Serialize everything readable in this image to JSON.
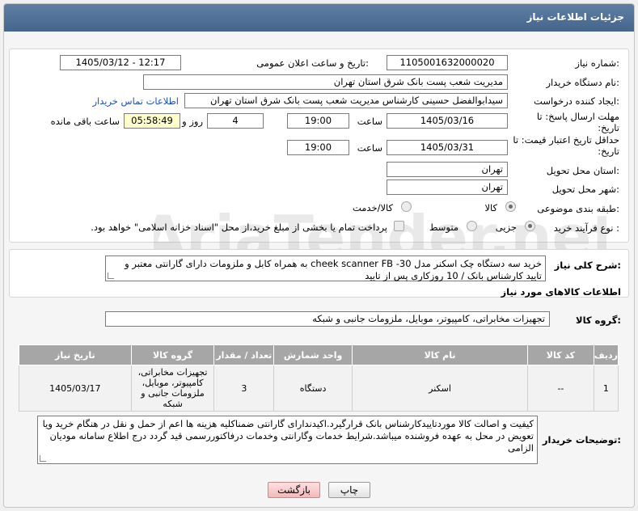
{
  "header": {
    "title": "جزئیات اطلاعات نیاز"
  },
  "form": {
    "need_number_label": "شماره نیاز:",
    "need_number": "1105001632000020",
    "announce_label": "تاریخ و ساعت اعلان عمومی:",
    "announce_value": "1405/03/12 - 12:17",
    "buyer_org_label": "نام دستگاه خریدار:",
    "buyer_org": "مدیریت شعب پست بانک شرق استان تهران",
    "requester_label": "ایجاد کننده درخواست:",
    "requester": "سیدابوالفضل حسینی کارشناس مدیریت شعب پست بانک شرق استان تهران",
    "contact_link": "اطلاعات تماس خریدار",
    "reply_deadline_label": "مهلت ارسال پاسخ: تا تاریخ:",
    "reply_date": "1405/03/16",
    "time_label": "ساعت",
    "reply_time": "19:00",
    "days_value": "4",
    "days_label": "روز و",
    "remaining_value": "05:58:49",
    "remaining_label": "ساعت باقی مانده",
    "price_validity_label": "حداقل تاریخ اعتبار قیمت: تا تاریخ:",
    "validity_date": "1405/03/31",
    "validity_time": "19:00",
    "province_label": "استان محل تحویل:",
    "province": "تهران",
    "city_label": "شهر محل تحویل:",
    "city": "تهران",
    "category_label": "طبقه بندی موضوعی:",
    "category_options": [
      "کالا",
      "کالا/خدمت"
    ],
    "process_label": "نوع فرآیند خرید :",
    "process_options": [
      "جزیی",
      "متوسط"
    ],
    "payment_note": "پرداخت تمام یا بخشی از مبلغ خرید،از محل \"اسناد خزانه اسلامی\" خواهد بود."
  },
  "summary": {
    "label": "شرح کلی نیاز:",
    "text": "خرید سه دستگاه چک اسکنر مدل cheek scanner FB -30 به همراه کابل و ملزومات دارای گارانتی معتبر و تایید کارشناس بانک / 10 روزکاری پس از تایید"
  },
  "goods": {
    "section_title": "اطلاعات کالاهای مورد نیاز",
    "group_label": "گروه کالا:",
    "group_value": "تجهیزات مخابراتی، کامپیوتر، موبایل، ملزومات جانبی و شبکه",
    "columns": [
      "ردیف",
      "کد کالا",
      "نام کالا",
      "واحد شمارش",
      "تعداد / مقدار",
      "گروه کالا",
      "تاریخ نیاز"
    ],
    "rows": [
      [
        "1",
        "--",
        "اسکنر",
        "دستگاه",
        "3",
        "تجهیزات مخابراتی، کامپیوتر، موبایل، ملزومات جانبی و شبکه",
        "1405/03/17"
      ]
    ]
  },
  "buyer_notes": {
    "label": "توضیحات خریدار:",
    "text": "کیفیت و اصالت کالا موردتاییدکارشناس بانک قرارگیرد.اکیدندارای گارانتی  ضمناکلیه هزینه ها اعم از حمل و نقل در هنگام خرید ویا تعویض در محل به عهده فروشنده میباشد.شرایط خدمات وگارانتی وخدمات درفاکتوررسمی قید گردد درج اطلاع سامانه مودیان الزامی"
  },
  "buttons": {
    "print": "چاپ",
    "back": "بازگشت"
  },
  "watermark": "AriaTender.net"
}
